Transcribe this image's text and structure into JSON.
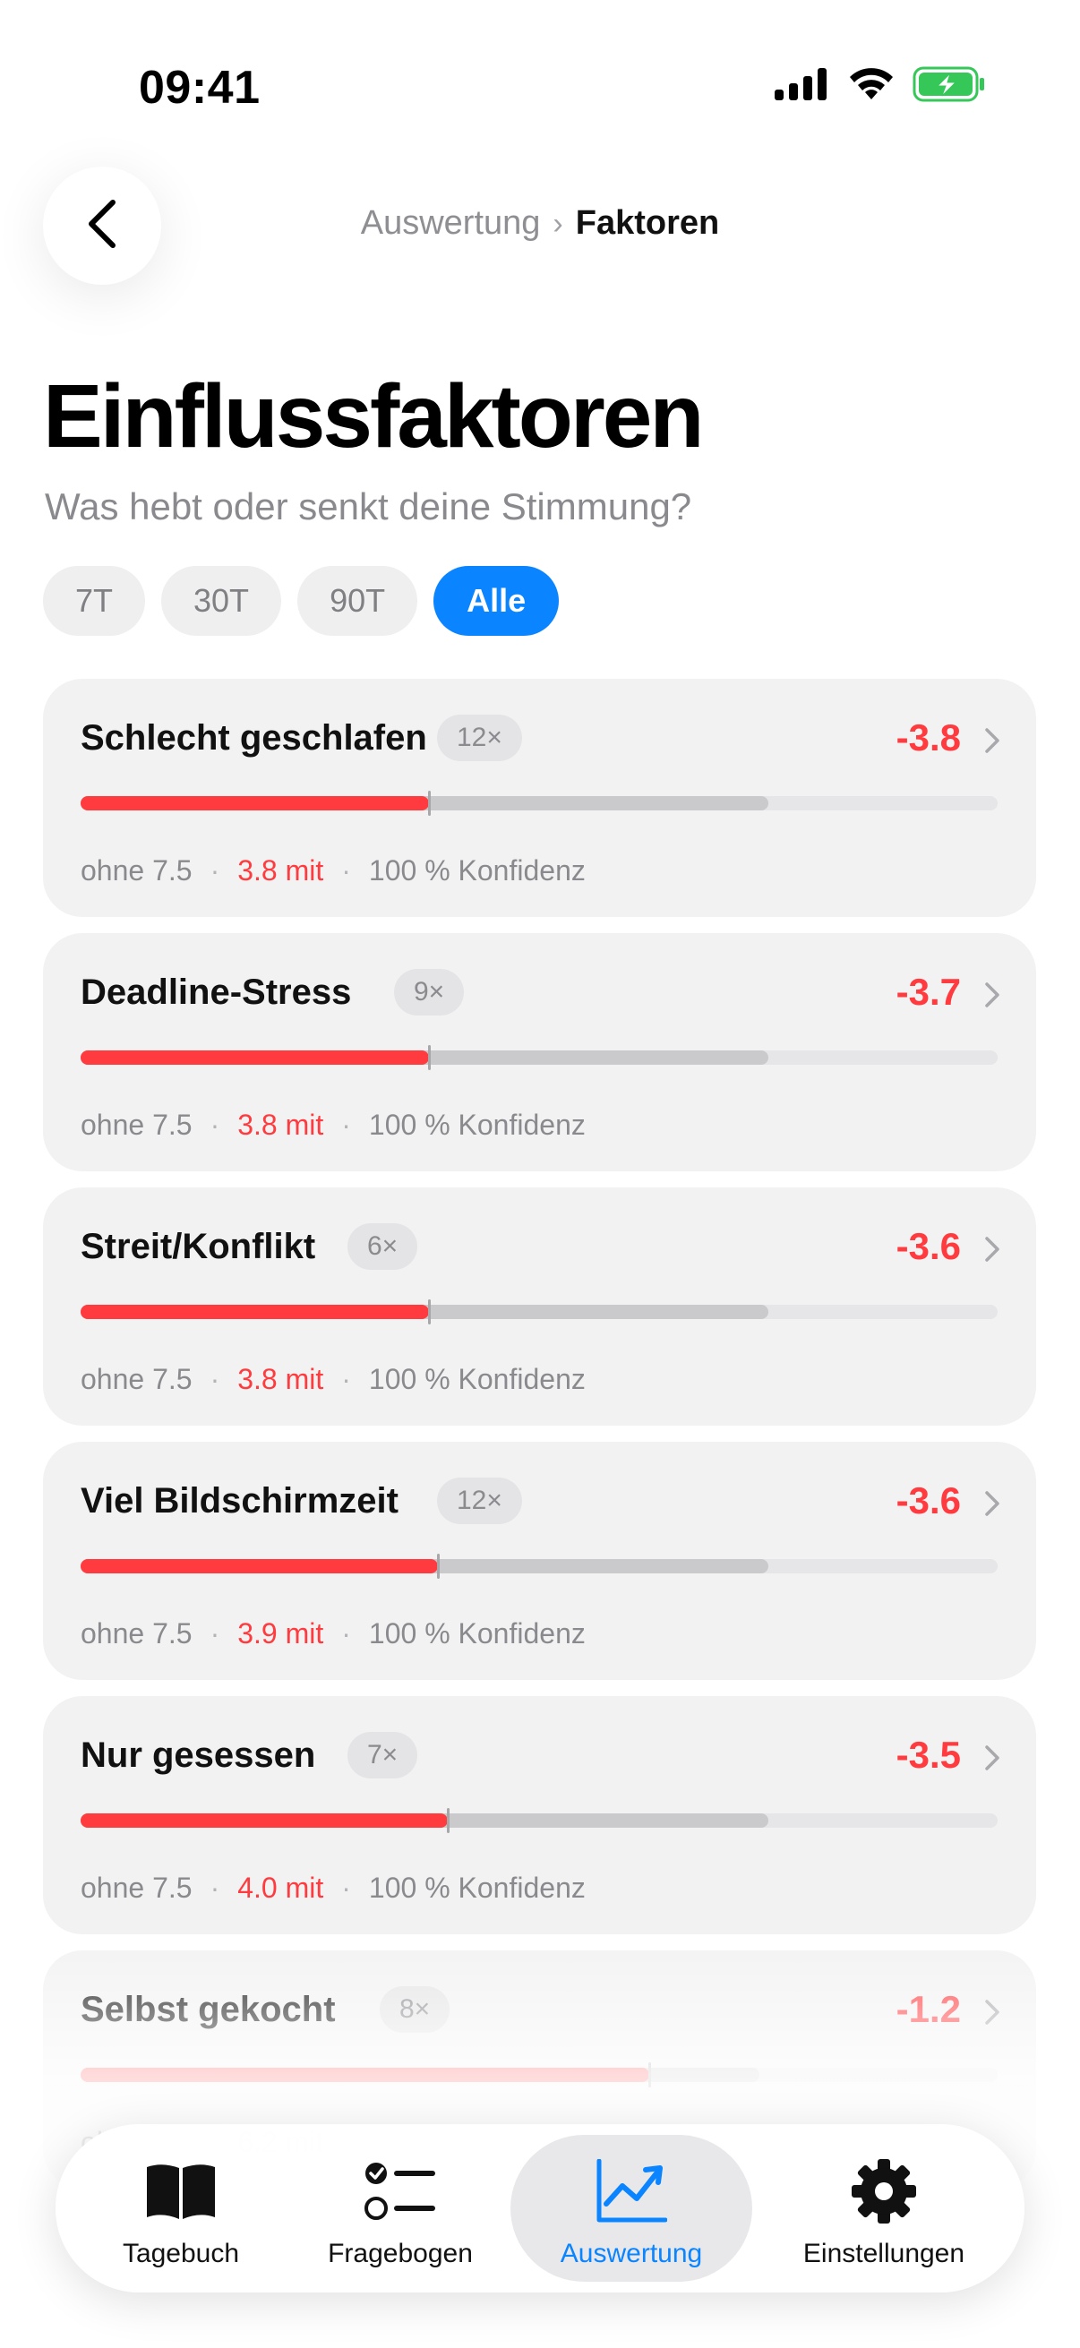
{
  "status_bar": {
    "time": "09:41"
  },
  "header": {
    "breadcrumb_parent": "Auswertung",
    "breadcrumb_separator": "›",
    "breadcrumb_current": "Faktoren"
  },
  "page": {
    "title": "Einflussfaktoren",
    "subtitle": "Was hebt oder senkt deine Stimmung?"
  },
  "filters": [
    {
      "label": "7T",
      "active": false
    },
    {
      "label": "30T",
      "active": false
    },
    {
      "label": "90T",
      "active": false
    },
    {
      "label": "Alle",
      "active": true
    }
  ],
  "factors": [
    {
      "name": "Schlecht geschlafen",
      "count": "12×",
      "delta": "-3.8",
      "without": "ohne 7.5",
      "with": "3.8 mit",
      "confidence": "100 % Konfidenz",
      "without_value": 7.5,
      "with_value": 3.8
    },
    {
      "name": "Deadline-Stress",
      "count": "9×",
      "delta": "-3.7",
      "without": "ohne 7.5",
      "with": "3.8 mit",
      "confidence": "100 % Konfidenz",
      "without_value": 7.5,
      "with_value": 3.8
    },
    {
      "name": "Streit/Konflikt",
      "count": "6×",
      "delta": "-3.6",
      "without": "ohne 7.5",
      "with": "3.8 mit",
      "confidence": "100 % Konfidenz",
      "without_value": 7.5,
      "with_value": 3.8
    },
    {
      "name": "Viel Bildschirmzeit",
      "count": "12×",
      "delta": "-3.6",
      "without": "ohne 7.5",
      "with": "3.9 mit",
      "confidence": "100 % Konfidenz",
      "without_value": 7.5,
      "with_value": 3.9
    },
    {
      "name": "Nur gesessen",
      "count": "7×",
      "delta": "-3.5",
      "without": "ohne 7.5",
      "with": "4.0 mit",
      "confidence": "100 % Konfidenz",
      "without_value": 7.5,
      "with_value": 4.0
    },
    {
      "name": "Selbst gekocht",
      "count": "8×",
      "delta": "-1.2",
      "without": "ohne 7.4",
      "with": "6.2 mit",
      "confidence": "100 % Konfidenz",
      "without_value": 7.4,
      "with_value": 6.2
    }
  ],
  "tabs": [
    {
      "label": "Tagebuch",
      "icon": "book-icon",
      "active": false
    },
    {
      "label": "Fragebogen",
      "icon": "checklist-icon",
      "active": false
    },
    {
      "label": "Auswertung",
      "icon": "chart-trend-icon",
      "active": true
    },
    {
      "label": "Einstellungen",
      "icon": "gear-icon",
      "active": false
    }
  ],
  "colors": {
    "accent": "#0a84ff",
    "negative": "#ff3b3f",
    "card_bg": "#f2f2f2"
  }
}
